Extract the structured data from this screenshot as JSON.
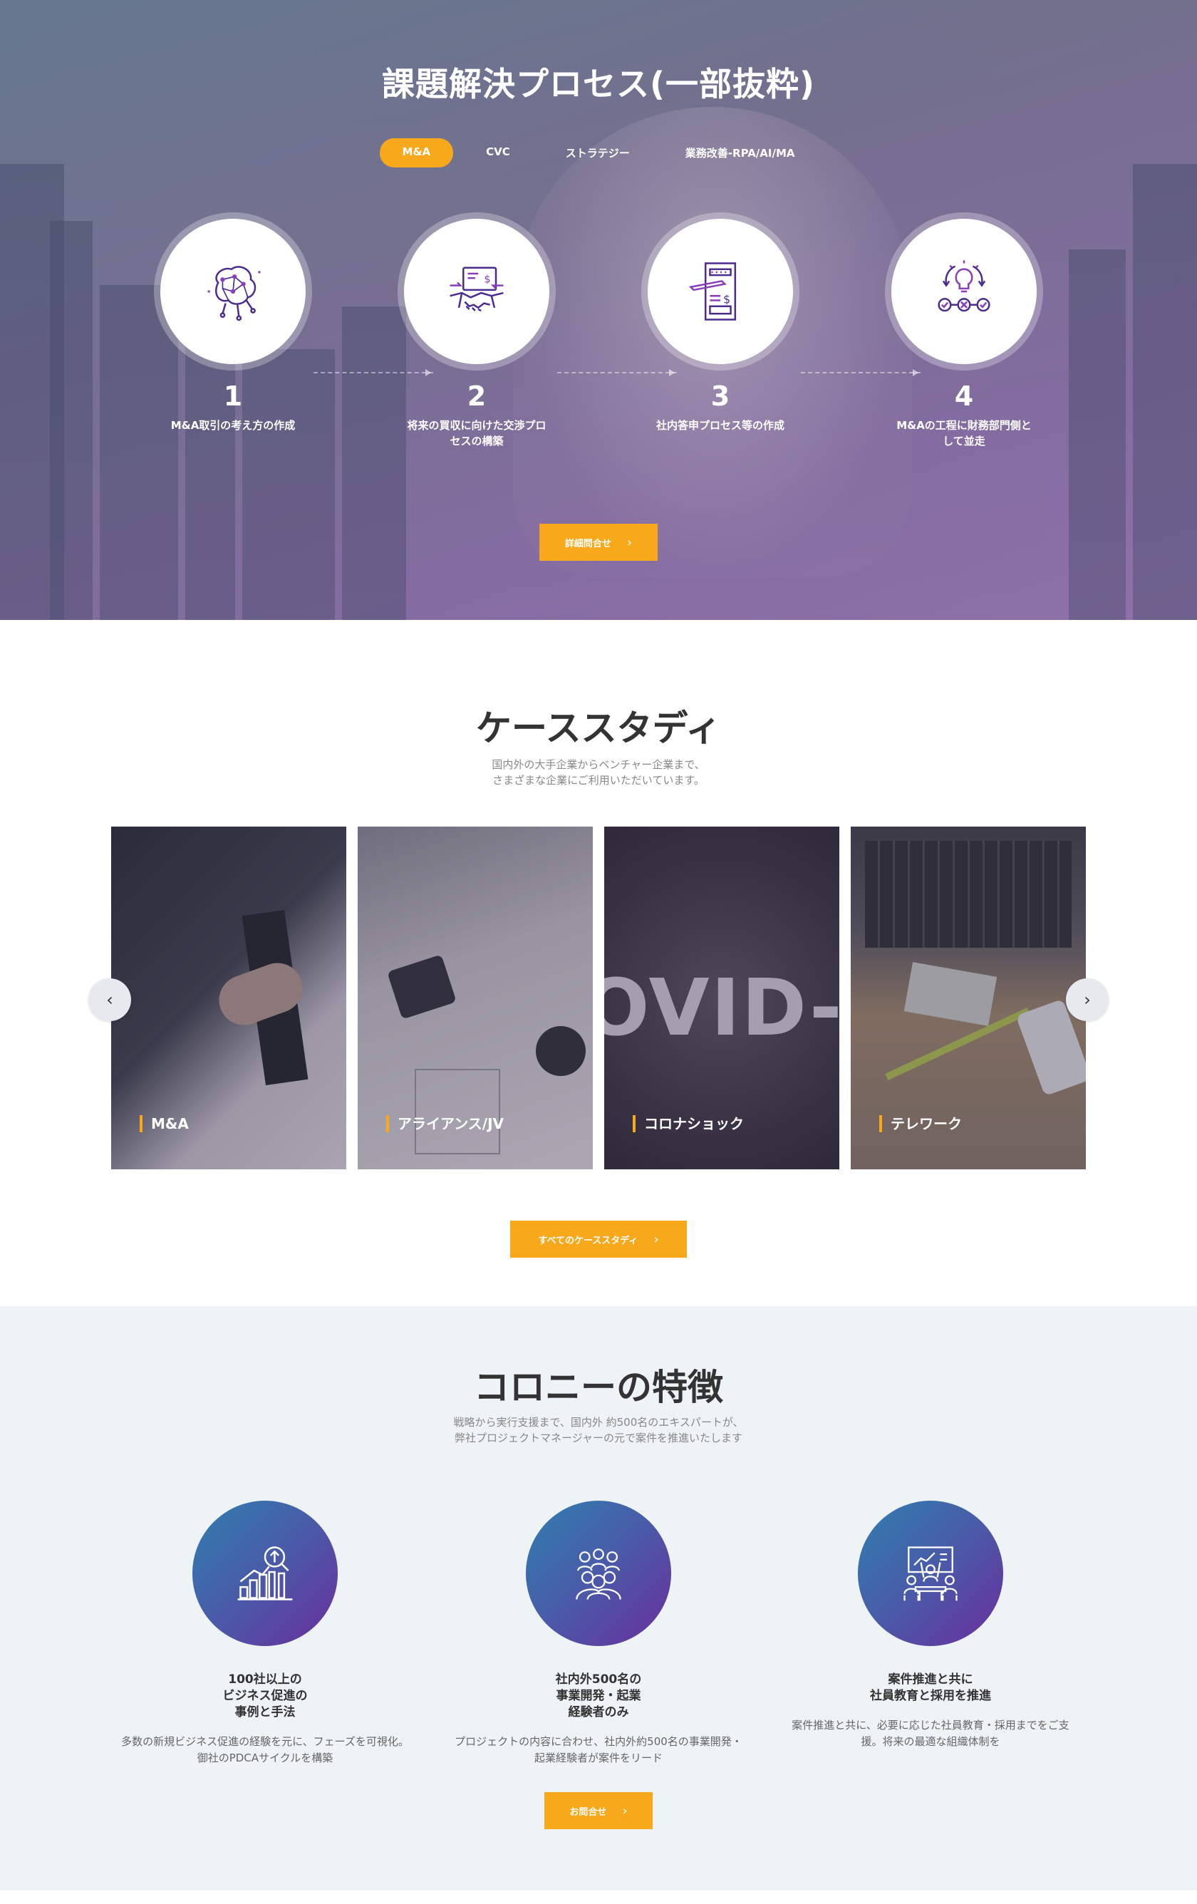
{
  "hero": {
    "title": "課題解決プロセス(一部抜粋)",
    "tabs": [
      {
        "label": "M&A",
        "active": true
      },
      {
        "label": "CVC",
        "active": false
      },
      {
        "label": "ストラテジー",
        "active": false
      },
      {
        "label": "業務改善-RPA/AI/MA",
        "active": false
      }
    ],
    "steps": [
      {
        "num": "1",
        "label": "M&A取引の考え方の作成",
        "icon": "brain-network-icon"
      },
      {
        "num": "2",
        "label": "将来の買収に向けた交渉プロセスの構築",
        "icon": "handshake-contract-icon"
      },
      {
        "num": "3",
        "label": "社内答申プロセス等の作成",
        "icon": "document-pen-icon"
      },
      {
        "num": "4",
        "label": "M&Aの工程に財務部門側として並走",
        "icon": "idea-cycle-icon"
      }
    ],
    "button": "詳細問合せ"
  },
  "cases": {
    "title": "ケーススタディ",
    "subtitle_1": "国内外の大手企業からベンチャー企業まで、",
    "subtitle_2": "さまざまな企業にご利用いただいています。",
    "cards": [
      {
        "label": "M&A"
      },
      {
        "label": "アライアンス/JV"
      },
      {
        "label": "コロナショック"
      },
      {
        "label": "テレワーク"
      }
    ],
    "prev": "‹",
    "next": "›",
    "button": "すべてのケーススタディ"
  },
  "features": {
    "title": "コロニーの特徴",
    "subtitle_1": "戦略から実行支援まで、国内外 約500名のエキスパートが、",
    "subtitle_2": "弊社プロジェクトマネージャーの元で案件を推進いたします",
    "items": [
      {
        "title_1": "100社以上の",
        "title_2": "ビジネス促進の",
        "title_3": "事例と手法",
        "desc_1": "多数の新規ビジネス促進の経験を元に、フェーズを可視化。",
        "desc_2": "御社のPDCAサイクルを構築",
        "icon": "growth-chart-icon"
      },
      {
        "title_1": "社内外500名の",
        "title_2": "事業開発・起業",
        "title_3": "経験者のみ",
        "desc_1": "プロジェクトの内容に合わせ、社内外約500名の事業開発・",
        "desc_2": "起業経験者が案件をリード",
        "icon": "team-group-icon"
      },
      {
        "title_1": "案件推進と共に",
        "title_2": "社員教育と採用を推進",
        "title_3": "",
        "desc_1": "案件推進と共に、必要に応じた社員教育・採用までをご支",
        "desc_2": "援。将来の最適な組織体制を",
        "icon": "meeting-board-icon"
      }
    ],
    "button": "お問合せ"
  },
  "colors": {
    "accent": "#f7a81b",
    "icon_purple": "#4b2c90",
    "feature_bg": "#eef3f5"
  }
}
